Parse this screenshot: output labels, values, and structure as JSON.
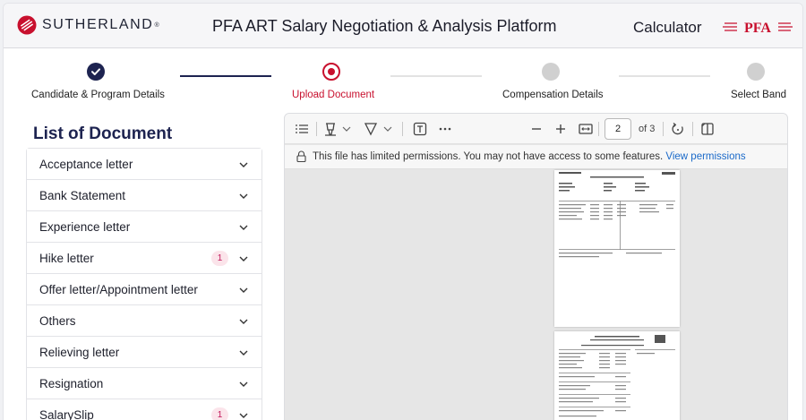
{
  "header": {
    "brand": "SUTHERLAND",
    "brand_tm": "®",
    "title": "PFA ART Salary Negotiation & Analysis Platform",
    "calculator_label": "Calculator",
    "pfa_logo_text": "PFA",
    "accent_color": "#c8102e"
  },
  "stepper": {
    "steps": [
      {
        "label": "Candidate & Program Details",
        "state": "completed"
      },
      {
        "label": "Upload Document",
        "state": "active"
      },
      {
        "label": "Compensation Details",
        "state": "pending"
      },
      {
        "label": "Select Band",
        "state": "pending"
      }
    ],
    "completed_color": "#1d2350",
    "active_color": "#c8102e",
    "pending_color": "#d0d0d0"
  },
  "documents": {
    "title": "List of Document",
    "items": [
      {
        "label": "Acceptance letter",
        "badge": ""
      },
      {
        "label": "Bank Statement",
        "badge": ""
      },
      {
        "label": "Experience letter",
        "badge": ""
      },
      {
        "label": "Hike letter",
        "badge": "1"
      },
      {
        "label": "Offer letter/Appointment letter",
        "badge": ""
      },
      {
        "label": "Others",
        "badge": ""
      },
      {
        "label": "Relieving letter",
        "badge": ""
      },
      {
        "label": "Resignation",
        "badge": ""
      },
      {
        "label": "SalarySlip",
        "badge": "1"
      }
    ]
  },
  "viewer": {
    "current_page": "2",
    "page_total": "of 3",
    "permission_message": "This file has limited permissions. You may not have access to some features.",
    "permission_link": "View permissions"
  }
}
